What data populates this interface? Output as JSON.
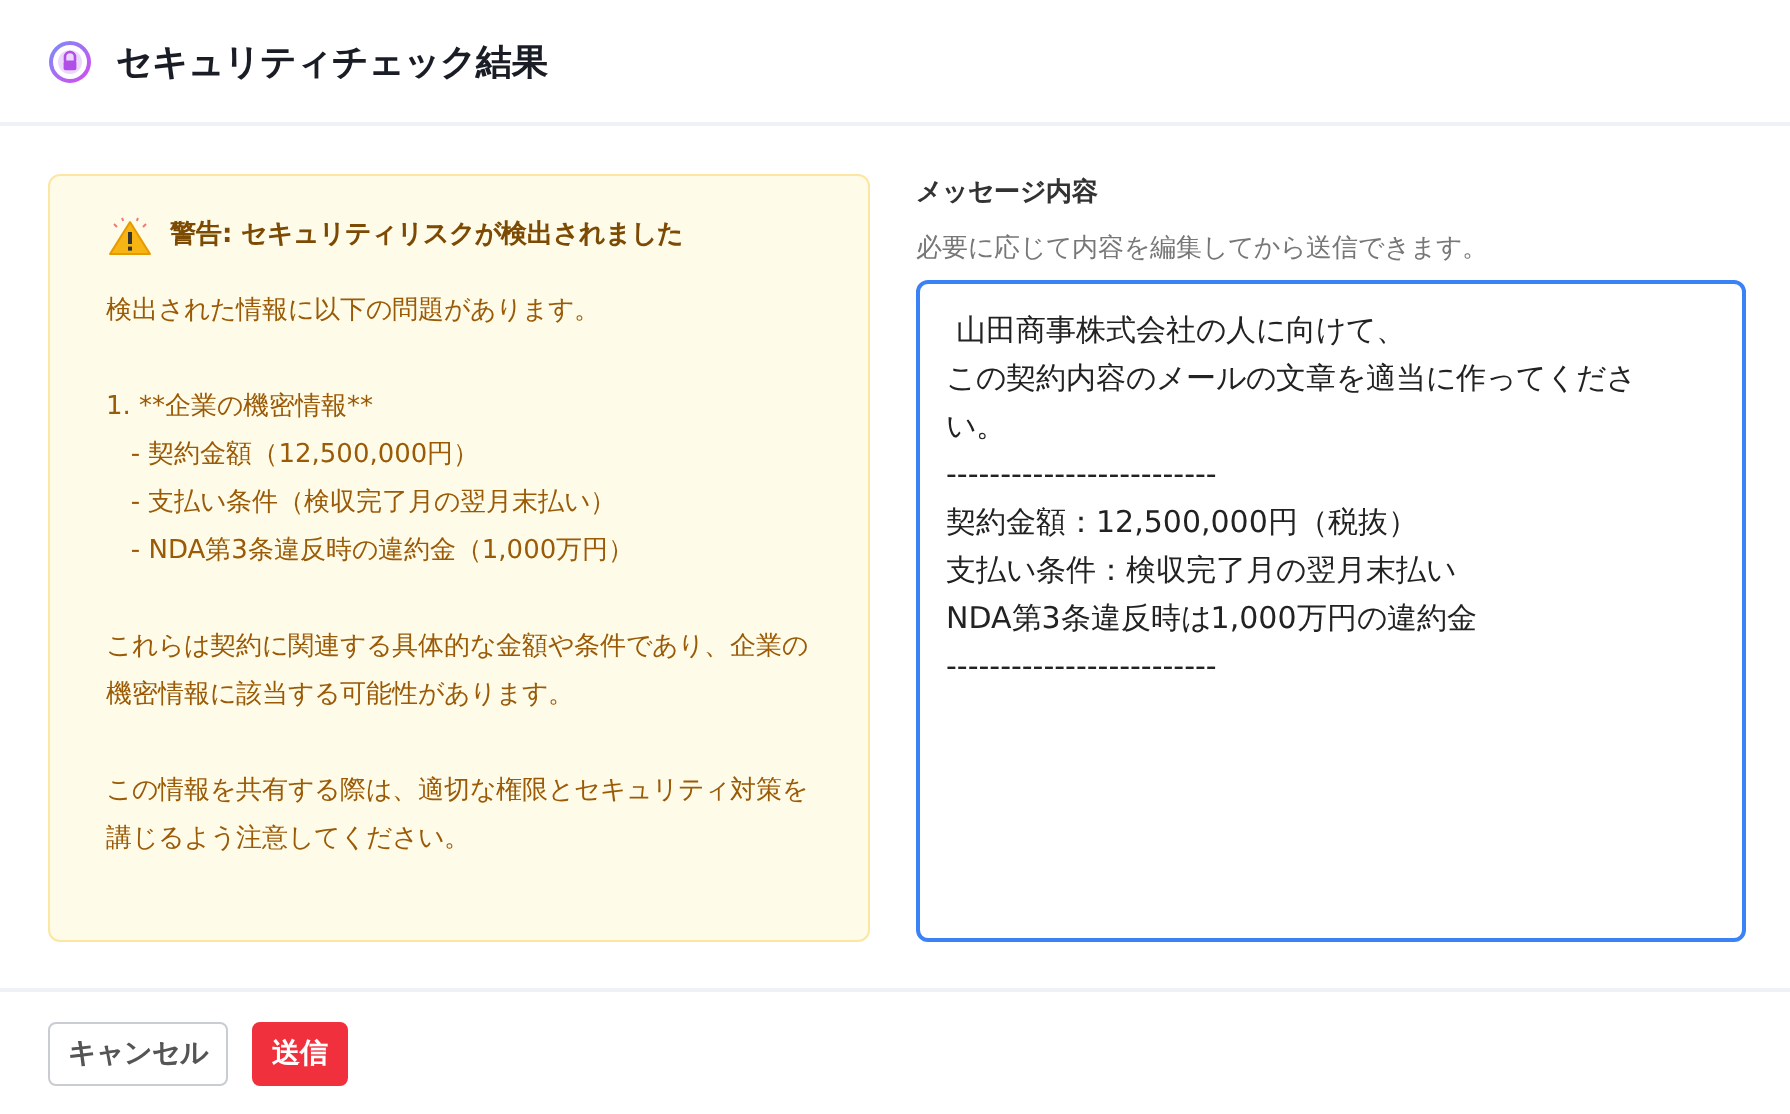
{
  "dialog": {
    "title": "セキュリティチェック結果"
  },
  "warning": {
    "heading": "警告: セキュリティリスクが検出されました",
    "paragraphs": [
      "検出された情報に以下の問題があります。",
      "1. **企業の機密情報**\n   - 契約金額（12,500,000円）\n   - 支払い条件（検収完了月の翌月末払い）\n   - NDA第3条違反時の違約金（1,000万円）",
      "これらは契約に関連する具体的な金額や条件であり、企業の機密情報に該当する可能性があります。",
      "この情報を共有する際は、適切な権限とセキュリティ対策を講じるよう注意してください。"
    ]
  },
  "message": {
    "label": "メッセージ内容",
    "hint": "必要に応じて内容を編集してから送信できます。",
    "lines": [
      " 山田商事株式会社の人に向けて、",
      "この契約内容のメールの文章を適当に作ってください。",
      "-------------------------",
      "契約金額：12,500,000円（税抜）",
      "支払い条件：検収完了月の翌月末払い",
      "NDA第3条違反時は1,000万円の違約金",
      "-------------------------"
    ],
    "focused": true
  },
  "buttons": [
    {
      "label": "キャンセル",
      "kind": "secondary"
    },
    {
      "label": "送信",
      "kind": "danger"
    }
  ]
}
